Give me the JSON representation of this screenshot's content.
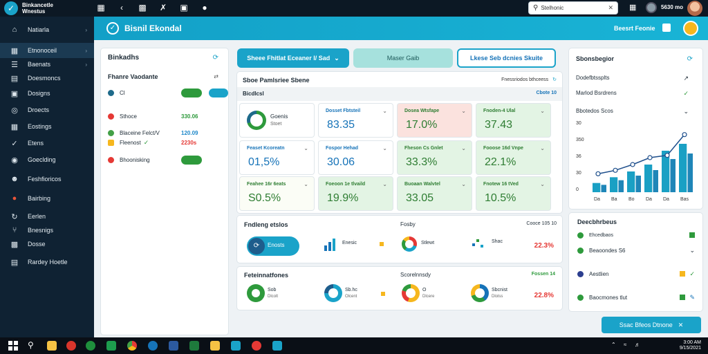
{
  "topbar": {
    "brand_line1": "Binkancetle",
    "brand_line2": "Wnestus",
    "search_placeholder": "Stelhonic",
    "user": "5630 mo"
  },
  "sidebar": {
    "items": [
      {
        "label": "Natiarla",
        "icon": "home-icon"
      },
      {
        "label": "Etnonoceil",
        "icon": "grid-icon",
        "active": true
      },
      {
        "label": "Baenats",
        "icon": "list-icon"
      },
      {
        "label": "Doesmoncs",
        "icon": "folder-icon"
      },
      {
        "label": "Dosigns",
        "icon": "monitor-icon"
      },
      {
        "label": "Droects",
        "icon": "globe-icon"
      },
      {
        "label": "Eostings",
        "icon": "table-icon"
      },
      {
        "label": "Etens",
        "icon": "check-icon"
      },
      {
        "label": "Goeclding",
        "icon": "pin-icon"
      },
      {
        "label": "Feshfioricos",
        "icon": "users-icon"
      },
      {
        "label": "Bairbing",
        "icon": "fire-icon"
      },
      {
        "label": "Eerlen",
        "icon": "refresh-icon"
      },
      {
        "label": "Bnesnigs",
        "icon": "fork-icon"
      },
      {
        "label": "Dosse",
        "icon": "apps-icon"
      },
      {
        "label": "Rardey Hoetle",
        "icon": "layout-icon"
      }
    ]
  },
  "banner": {
    "title": "Bisnil Ekondal",
    "user": "Beesrt Feonie"
  },
  "left_panel": {
    "title": "Binkadhs",
    "sub": "Fhanre Vaodante",
    "rows": [
      {
        "label": "Cl",
        "dot": "#1e6a8a",
        "value": "",
        "pill1": "",
        "pill2": ""
      },
      {
        "label": "Sthoce",
        "dot": "#e53935",
        "value": "330.06",
        "color": "#2e9a3c"
      },
      {
        "label": "Blaceine Felct/V",
        "dot": "#43a047",
        "value": "120.09",
        "color": "#1e88c9"
      },
      {
        "label": "Fleenost",
        "dot": "#f6b71e",
        "value": "2230s",
        "color": "#e53935"
      },
      {
        "label": "Bhoonisking",
        "dot": "#e53935",
        "value": "",
        "color": ""
      }
    ]
  },
  "tabs": [
    {
      "label": "Sheee Fhitlat Eceaner l/ Sad"
    },
    {
      "label": "Maser Gaib"
    },
    {
      "label": "Lkese Seb dcnies Skuite"
    }
  ],
  "summary": {
    "title": "Sboe Pamlsriee Sbene",
    "right": "Fnessriodos bthceess",
    "sub": "Bicdlcsl",
    "sub_right": "Cbote 10",
    "ring_label1": "Goenis",
    "ring_label2": "Stoet",
    "kpis": [
      {
        "label": "Dosset Fbtsteil",
        "value": "83.35",
        "color": "#1673b8",
        "bg": "#ffffff"
      },
      {
        "label": "Dosea Wtsfape",
        "value": "17.0%",
        "color": "#2e7d32",
        "bg": "#fbe2de"
      },
      {
        "label": "Fnoden-4 Ulal",
        "value": "37.43",
        "color": "#2e7d32",
        "bg": "#e3f4e4"
      },
      {
        "label": "Feaset Kcoreatn",
        "value": "01,5%",
        "color": "#1673b8",
        "bg": "#ffffff"
      },
      {
        "label": "Fospor Hehad",
        "value": "30.06",
        "color": "#1673b8",
        "bg": "#ffffff"
      },
      {
        "label": "Fheson Cs Gnlet",
        "value": "33.3%",
        "color": "#2e7d32",
        "bg": "#e3f4e4"
      },
      {
        "label": "Fooose 16d Vnpe",
        "value": "22.1%",
        "color": "#2e7d32",
        "bg": "#e3f4e4"
      },
      {
        "label": "Feahee 16r 6eats",
        "value": "S0.5%",
        "color": "#2e7d32",
        "bg": "#fbfdf6"
      },
      {
        "label": "Foeoon 1e tlvaild",
        "value": "19.9%",
        "color": "#2e7d32",
        "bg": "#e3f4e4"
      },
      {
        "label": "Buoaan Walvtel",
        "value": "33.05",
        "color": "#2e7d32",
        "bg": "#e3f4e4"
      },
      {
        "label": "Fnotew 16 tVed",
        "value": "10.5%",
        "color": "#2e7d32",
        "bg": "#e3f4e4"
      }
    ]
  },
  "mid_card": {
    "title": "Fndleng etslos",
    "center": "Fosby",
    "right": "Cooce 105 10",
    "items": [
      {
        "label": "Enosts",
        "sub": ""
      },
      {
        "label": "Enesic",
        "sub": ""
      },
      {
        "label": "Stlewt",
        "sub": ""
      },
      {
        "label": "Shac",
        "sub": ""
      }
    ],
    "value": "22.3%"
  },
  "bottom_card": {
    "title": "Feteinnatfones",
    "center": "Scorelnnsdy",
    "right": "Fossen 14",
    "items": [
      {
        "label": "Sob",
        "sub": "Dlcolt"
      },
      {
        "label": "Sb.hc",
        "sub": "Olcent"
      },
      {
        "label": "O",
        "sub": "Dlcere"
      },
      {
        "label": "Sbcnist",
        "sub": "Dlolss"
      }
    ],
    "value": "22.8%"
  },
  "right_chart_card": {
    "title": "Sbonsbegior",
    "rows": [
      "Dodefbtssplts",
      "Marlod Bsrdrens",
      "Bbotedos Scos"
    ],
    "ylabels": [
      "30",
      "350",
      "36",
      "30",
      "0"
    ]
  },
  "right_list_card": {
    "title": "Deecbhrbeus",
    "rows": [
      {
        "label": "Ehcedbaos",
        "dot": "#2e9a3c"
      },
      {
        "label": "Beaoondes S6",
        "dot": "#2e9a3c"
      },
      {
        "label": "Aestlien",
        "dot": "#2c3e8f"
      },
      {
        "label": "Baocmones tlut",
        "dot": "#2e9a3c"
      }
    ]
  },
  "action_button": "Ssac Bfeos Dtnone",
  "chart_data": {
    "type": "bar",
    "categories": [
      "Da",
      "Ba",
      "Bo",
      "Da",
      "Da",
      "Bas"
    ],
    "values": [
      40,
      65,
      90,
      120,
      180,
      210
    ],
    "line_values": [
      80,
      95,
      120,
      150,
      160,
      250
    ],
    "ylim": [
      0,
      300
    ]
  },
  "taskbar": {
    "time": "3:00 AM",
    "date": "9/15/2021"
  }
}
